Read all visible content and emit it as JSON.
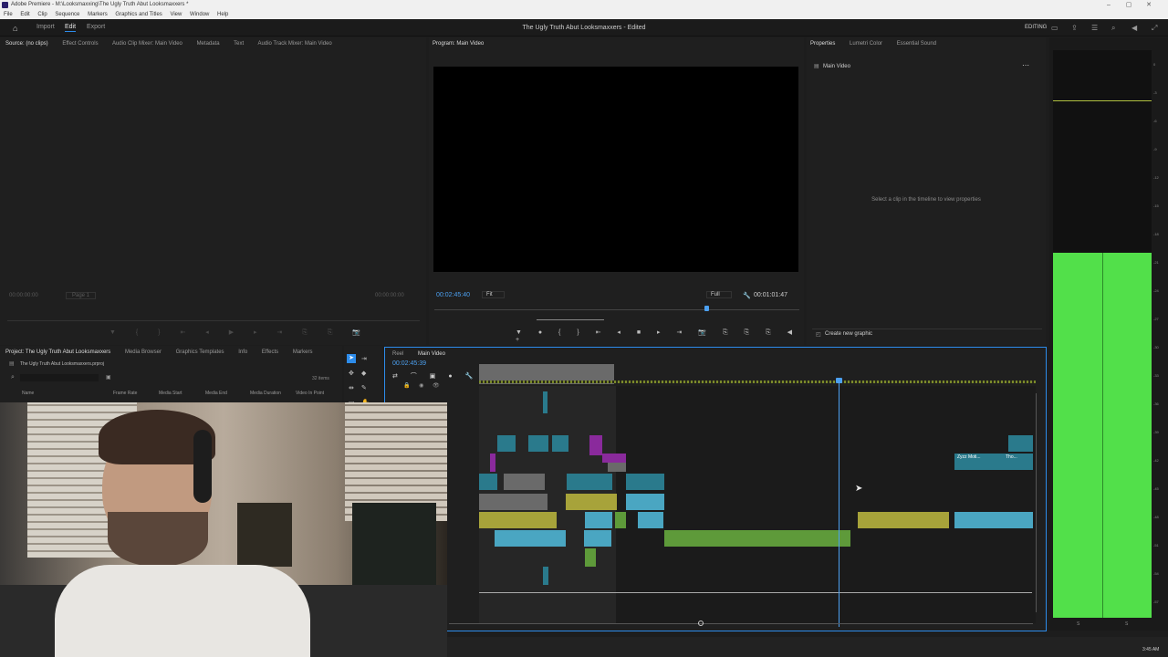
{
  "window": {
    "title": "Adobe Premiere - M:\\Looksmaxxing\\The Ugly Truth Abut Looksmaxxers *",
    "controls": [
      "–",
      "▢",
      "✕"
    ]
  },
  "menu": [
    "File",
    "Edit",
    "Clip",
    "Sequence",
    "Markers",
    "Graphics and Titles",
    "View",
    "Window",
    "Help"
  ],
  "appbar": {
    "workspaces": [
      "Import",
      "Edit",
      "Export"
    ],
    "active": "Edit",
    "doc_title": "The Ugly Truth Abut Looksmaxxers - Edited",
    "mode": "EDITING"
  },
  "source": {
    "tabs": [
      "Source: (no clips)",
      "Effect Controls",
      "Audio Clip Mixer: Main Video",
      "Metadata",
      "Text",
      "Audio Track Mixer: Main Video"
    ],
    "tc_left": "00:00:00:00",
    "page": "Page 1",
    "tc_right": "00:00:00:00"
  },
  "program": {
    "tab": "Program: Main Video",
    "tc": "00:02:45:40",
    "fit": "Fit",
    "quality": "Full",
    "duration": "00:01:01:47"
  },
  "properties": {
    "tabs": [
      "Properties",
      "Lumetri Color",
      "Essential Sound"
    ],
    "item": "Main Video",
    "hint": "Select a clip in the timeline to view properties",
    "create": "Create new graphic"
  },
  "project": {
    "tabs": [
      "Project: The Ugly Truth Abut Looksmaxxers",
      "Media Browser",
      "Graphics Templates",
      "Info",
      "Effects",
      "Markers"
    ],
    "file": "The Ugly Truth Abut Looksmaxxers.prproj",
    "items": "32 items",
    "cols": [
      "Name",
      "Frame Rate",
      "Media Start",
      "Media End",
      "Media Duration",
      "Video In Point"
    ]
  },
  "timeline": {
    "tabs": [
      "Reel",
      "Main Video"
    ],
    "tc": "00:02:45:39",
    "clip_labels": [
      "Zyzz Moti...",
      "Tho..."
    ]
  },
  "meter": {
    "scale": [
      "0",
      "-3",
      "-6",
      "-9",
      "-12",
      "-15",
      "-18",
      "-21",
      "-24",
      "-27",
      "-30",
      "-33",
      "-36",
      "-39",
      "-42",
      "-45",
      "-48",
      "-51",
      "-54",
      "-57"
    ],
    "bottom": [
      "S",
      "S"
    ]
  },
  "status": {
    "time": "3:45 AM"
  }
}
